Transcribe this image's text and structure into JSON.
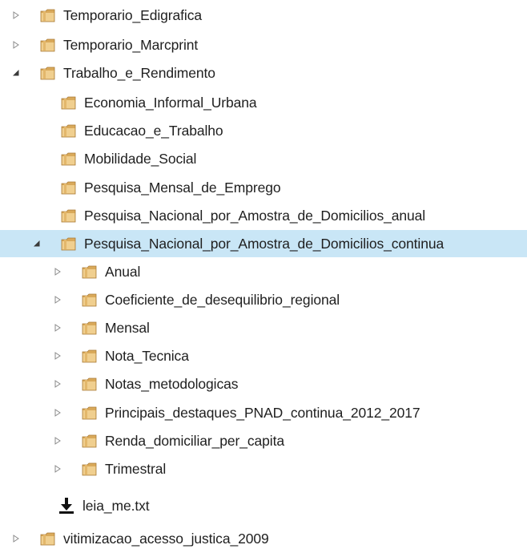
{
  "tree": {
    "items": [
      {
        "label": "Temporario_Edigrafica",
        "icon": "folder-icon",
        "expander": "collapsed"
      },
      {
        "label": "Temporario_Marcprint",
        "icon": "folder-icon",
        "expander": "collapsed"
      },
      {
        "label": "Trabalho_e_Rendimento",
        "icon": "folder-icon",
        "expander": "expanded"
      },
      {
        "label": "Economia_Informal_Urbana",
        "icon": "folder-icon"
      },
      {
        "label": "Educacao_e_Trabalho",
        "icon": "folder-icon"
      },
      {
        "label": "Mobilidade_Social",
        "icon": "folder-icon"
      },
      {
        "label": "Pesquisa_Mensal_de_Emprego",
        "icon": "folder-icon"
      },
      {
        "label": "Pesquisa_Nacional_por_Amostra_de_Domicilios_anual",
        "icon": "folder-icon"
      },
      {
        "label": "Pesquisa_Nacional_por_Amostra_de_Domicilios_continua",
        "icon": "folder-icon",
        "expander": "expanded",
        "selected": true
      },
      {
        "label": "Anual",
        "icon": "folder-icon",
        "expander": "collapsed"
      },
      {
        "label": "Coeficiente_de_desequilibrio_regional",
        "icon": "folder-icon",
        "expander": "collapsed"
      },
      {
        "label": "Mensal",
        "icon": "folder-icon",
        "expander": "collapsed"
      },
      {
        "label": "Nota_Tecnica",
        "icon": "folder-icon",
        "expander": "collapsed"
      },
      {
        "label": "Notas_metodologicas",
        "icon": "folder-icon",
        "expander": "collapsed"
      },
      {
        "label": "Principais_destaques_PNAD_continua_2012_2017",
        "icon": "folder-icon",
        "expander": "collapsed"
      },
      {
        "label": "Renda_domiciliar_per_capita",
        "icon": "folder-icon",
        "expander": "collapsed"
      },
      {
        "label": "Trimestral",
        "icon": "folder-icon",
        "expander": "collapsed"
      },
      {
        "label": "leia_me.txt",
        "icon": "download-icon"
      },
      {
        "label": "vitimizacao_acesso_justica_2009",
        "icon": "folder-icon",
        "expander": "collapsed"
      }
    ]
  },
  "colors": {
    "selection": "#c9e6f6",
    "folder": "#e8c27a",
    "expander": "#8a8a8a"
  }
}
